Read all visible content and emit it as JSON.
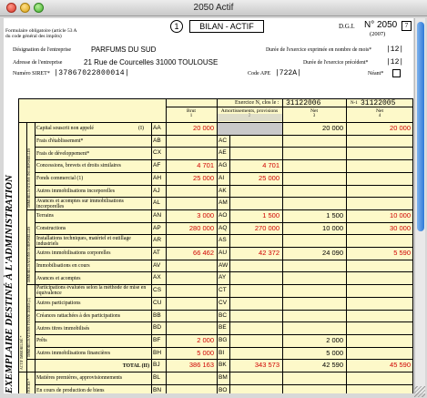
{
  "window": {
    "title": "2050 Actif"
  },
  "header": {
    "form_number": "1",
    "form_title": "BILAN - ACTIF",
    "dgi": "D.G.I.",
    "no": "N° 2050",
    "page_box": "7",
    "year": "(2007)",
    "legal_note_1": "Formulaire obligatoire (article 53 A",
    "legal_note_2": "du code général des impôts)",
    "company_label": "Désignation de l'entreprise",
    "company": "PARFUMS DU SUD",
    "address_label": "Adresse de l'entreprise",
    "address": "21 Rue de Courcelles 31000 TOULOUSE",
    "siret_label": "Numéro SIRET*",
    "siret": "|37867022800014|",
    "duration_label": "Durée de l'exercice exprimée en nombre de mois*",
    "duration": "|12|",
    "prev_duration_label": "Durée de l'exercice précédent*",
    "prev_duration": "|12|",
    "ape_label": "Code APE",
    "ape": "|722A|",
    "neant_label": "Néant*"
  },
  "columns": {
    "exercise_label": "Exercice N, clos le :",
    "exercise_date": "31122006",
    "prev_label": "N-1",
    "prev_date": "31122005",
    "brut": "Brut",
    "brut_n": "1",
    "amort": "Amortissements, provisions",
    "amort_n": "2",
    "net": "Net",
    "net_n": "3",
    "net_prev": "Net",
    "net_prev_n": "4"
  },
  "side_labels": {
    "main": "EXEMPLAIRE DESTINÉ À L'ADMINISTRATION",
    "actif": "ACTIF IMMOBILISÉ *",
    "incorp": "IMMOBILISATIONS INCORPORELLES",
    "corp": "IMMOBILISATIONS CORPORELLES",
    "fin": "IMMOBILISATIONS FINANCIÈRES (2)",
    "stock": "STOCKS *"
  },
  "rows": [
    {
      "label": "Capital souscrit non appelé",
      "suffix": "(I)",
      "c1": "AA",
      "v1": "20 000",
      "c2": "",
      "v2": "",
      "v3": "20 000",
      "v4": "20 000",
      "grey": true
    },
    {
      "label": "Frais d'établissement*",
      "c1": "AB",
      "v1": "",
      "c2": "AC",
      "v2": "",
      "v3": "",
      "v4": ""
    },
    {
      "label": "Frais de développement*",
      "c1": "CX",
      "v1": "",
      "c2": "AE",
      "v2": "",
      "v3": "",
      "v4": ""
    },
    {
      "label": "Concessions, brevets et droits similaires",
      "c1": "AF",
      "v1": "4 701",
      "c2": "AG",
      "v2": "4 701",
      "v3": "",
      "v4": ""
    },
    {
      "label": "Fonds commercial (1)",
      "c1": "AH",
      "v1": "25 000",
      "c2": "AI",
      "v2": "25 000",
      "v3": "",
      "v4": ""
    },
    {
      "label": "Autres immobilisations incorporelles",
      "c1": "AJ",
      "v1": "",
      "c2": "AK",
      "v2": "",
      "v3": "",
      "v4": ""
    },
    {
      "label": "Avances et acomptes sur immobilisations incorporelles",
      "c1": "AL",
      "v1": "",
      "c2": "AM",
      "v2": "",
      "v3": "",
      "v4": ""
    },
    {
      "label": "Terrains",
      "c1": "AN",
      "v1": "3 000",
      "c2": "AO",
      "v2": "1 500",
      "v3": "1 500",
      "v4": "10 000"
    },
    {
      "label": "Constructions",
      "c1": "AP",
      "v1": "280 000",
      "c2": "AQ",
      "v2": "270 000",
      "v3": "10 000",
      "v4": "30 000"
    },
    {
      "label": "Installations techniques, matériel et outillage industriels",
      "c1": "AR",
      "v1": "",
      "c2": "AS",
      "v2": "",
      "v3": "",
      "v4": ""
    },
    {
      "label": "Autres immobilisations corporelles",
      "c1": "AT",
      "v1": "66 462",
      "c2": "AU",
      "v2": "42 372",
      "v3": "24 090",
      "v4": "5 590"
    },
    {
      "label": "Immobilisations en cours",
      "c1": "AV",
      "v1": "",
      "c2": "AW",
      "v2": "",
      "v3": "",
      "v4": ""
    },
    {
      "label": "Avances et acomptes",
      "c1": "AX",
      "v1": "",
      "c2": "AY",
      "v2": "",
      "v3": "",
      "v4": ""
    },
    {
      "label": "Participations évaluées selon la méthode de mise en équivalence",
      "c1": "CS",
      "v1": "",
      "c2": "CT",
      "v2": "",
      "v3": "",
      "v4": ""
    },
    {
      "label": "Autres participations",
      "c1": "CU",
      "v1": "",
      "c2": "CV",
      "v2": "",
      "v3": "",
      "v4": ""
    },
    {
      "label": "Créances rattachées à des participations",
      "c1": "BB",
      "v1": "",
      "c2": "BC",
      "v2": "",
      "v3": "",
      "v4": ""
    },
    {
      "label": "Autres titres immobilisés",
      "c1": "BD",
      "v1": "",
      "c2": "BE",
      "v2": "",
      "v3": "",
      "v4": ""
    },
    {
      "label": "Prêts",
      "c1": "BF",
      "v1": "2 000",
      "c2": "BG",
      "v2": "",
      "v3": "2 000",
      "v4": ""
    },
    {
      "label": "Autres immobilisations financières",
      "c1": "BH",
      "v1": "5 000",
      "c2": "BI",
      "v2": "",
      "v3": "5 000",
      "v4": ""
    },
    {
      "label": "TOTAL (II)",
      "c1": "BJ",
      "v1": "386 163",
      "c2": "BK",
      "v2": "343 573",
      "v3": "42 590",
      "v4": "45 590",
      "total": true
    },
    {
      "label": "Matières premières, approvisionnements",
      "c1": "BL",
      "v1": "",
      "c2": "BM",
      "v2": "",
      "v3": "",
      "v4": ""
    },
    {
      "label": "En cours de production de biens",
      "c1": "BN",
      "v1": "",
      "c2": "BO",
      "v2": "",
      "v3": "",
      "v4": ""
    }
  ]
}
